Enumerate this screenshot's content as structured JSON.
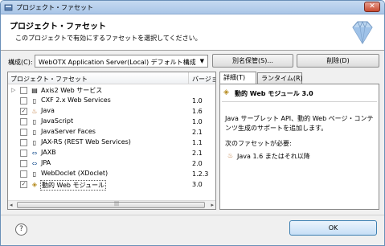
{
  "window": {
    "title": "プロジェクト・ファセット",
    "close_symbol": "✕"
  },
  "header": {
    "title": "プロジェクト・ファセット",
    "description": "このプロジェクトで有効にするファセットを選択してください。"
  },
  "configuration": {
    "label": "構成(C):",
    "selected": "WebOTX Application Server(Local) デフォルト構成",
    "save_as_label": "別名保管(S)...",
    "delete_label": "削除(D)"
  },
  "facets": {
    "column_name": "プロジェクト・ファセット",
    "column_version": "バージョン",
    "items": [
      {
        "name": "Axis2 Web サービス",
        "version": "",
        "checked": false,
        "expandable": true,
        "icon": "folder-icon"
      },
      {
        "name": "CXF 2.x Web Services",
        "version": "1.0",
        "checked": false,
        "expandable": false,
        "icon": "doc-icon"
      },
      {
        "name": "Java",
        "version": "1.6",
        "checked": true,
        "expandable": false,
        "icon": "java-icon"
      },
      {
        "name": "JavaScript",
        "version": "1.0",
        "checked": false,
        "expandable": false,
        "icon": "doc-icon"
      },
      {
        "name": "JavaServer Faces",
        "version": "2.1",
        "checked": false,
        "expandable": false,
        "icon": "doc-icon"
      },
      {
        "name": "JAX-RS (REST Web Services)",
        "version": "1.1",
        "checked": false,
        "expandable": false,
        "icon": "doc-icon"
      },
      {
        "name": "JAXB",
        "version": "2.1",
        "checked": false,
        "expandable": false,
        "icon": "arrows-icon"
      },
      {
        "name": "JPA",
        "version": "2.0",
        "checked": false,
        "expandable": false,
        "icon": "arrows-icon"
      },
      {
        "name": "WebDoclet (XDoclet)",
        "version": "1.2.3",
        "checked": false,
        "expandable": false,
        "icon": "doc-icon"
      },
      {
        "name": "動的 Web モジュール",
        "version": "3.0",
        "checked": true,
        "expandable": false,
        "icon": "web-module-icon",
        "selected": true
      }
    ]
  },
  "details": {
    "tab_details": "詳細(T)",
    "tab_runtime": "ランタイム(R)",
    "title": "動的 Web モジュール 3.0",
    "description": "Java サーブレット API、動的 Web ページ・コンテンツ生成のサポートを追加します。",
    "requires_label": "次のファセットが必要:",
    "requirement": "Java 1.6 またはそれ以降"
  },
  "footer": {
    "help_symbol": "?",
    "ok_label": "OK"
  }
}
